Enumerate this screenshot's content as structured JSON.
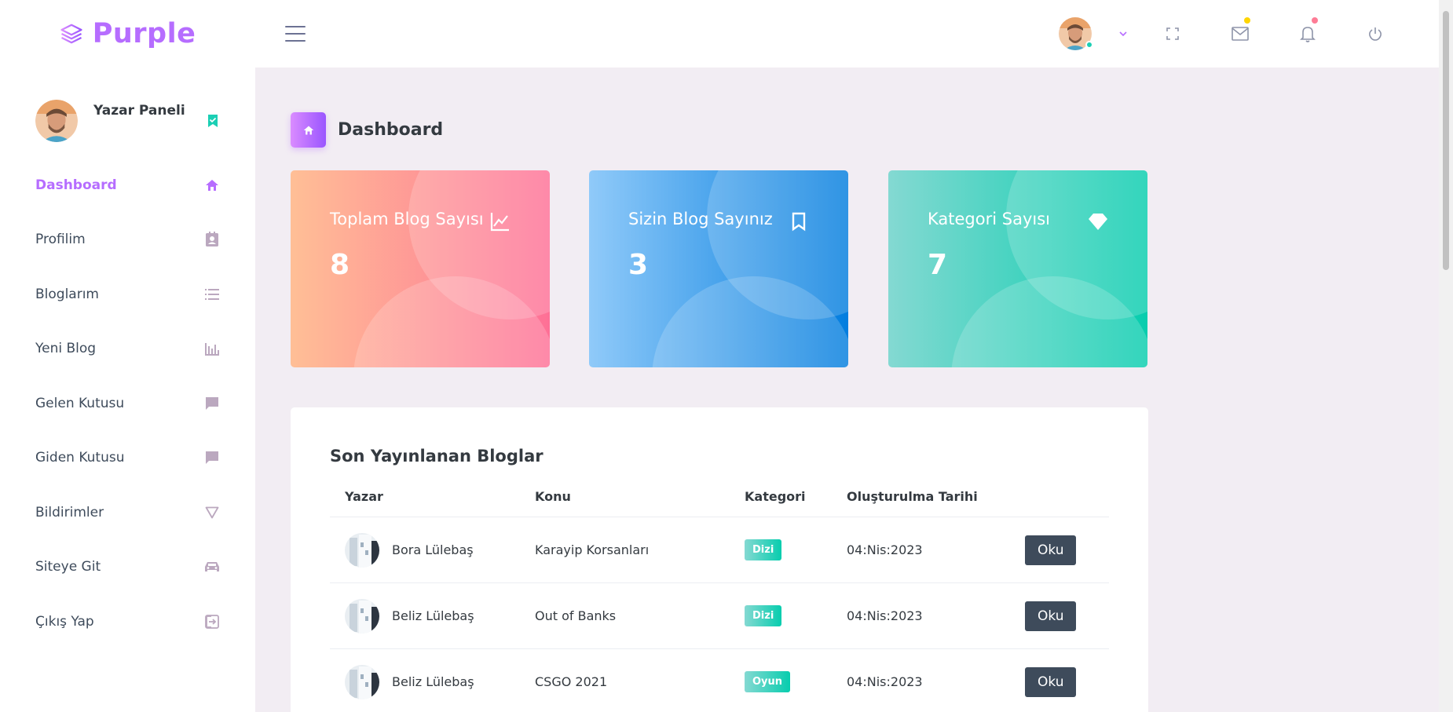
{
  "brand": {
    "name": "Purple",
    "color": "#b66dff"
  },
  "navbar": {
    "icons": [
      "chevron-down-icon",
      "fullscreen-icon",
      "mail-icon",
      "bell-icon",
      "power-icon"
    ],
    "mail_badge_color": "#ffd500",
    "bell_badge_color": "#fe7c96"
  },
  "sidebar": {
    "profile_name": "Yazar Paneli",
    "items": [
      {
        "label": "Dashboard",
        "icon": "home-icon",
        "active": true
      },
      {
        "label": "Profilim",
        "icon": "contact-card-icon"
      },
      {
        "label": "Bloglarım",
        "icon": "list-icon"
      },
      {
        "label": "Yeni Blog",
        "icon": "bar-chart-icon"
      },
      {
        "label": "Gelen Kutusu",
        "icon": "message-icon"
      },
      {
        "label": "Giden Kutusu",
        "icon": "message-icon"
      },
      {
        "label": "Bildirimler",
        "icon": "triangle-down-icon"
      },
      {
        "label": "Siteye Git",
        "icon": "car-icon"
      },
      {
        "label": "Çıkış Yap",
        "icon": "logout-icon"
      }
    ]
  },
  "page": {
    "title": "Dashboard"
  },
  "stats": [
    {
      "label": "Toplam Blog Sayısı",
      "value": "8",
      "icon": "chart-line-icon"
    },
    {
      "label": "Sizin Blog Sayınız",
      "value": "3",
      "icon": "bookmark-icon"
    },
    {
      "label": "Kategori Sayısı",
      "value": "7",
      "icon": "diamond-icon"
    }
  ],
  "recent": {
    "title": "Son Yayınlanan Bloglar",
    "columns": [
      "Yazar",
      "Konu",
      "Kategori",
      "Oluşturulma Tarihi"
    ],
    "rows": [
      {
        "author": "Bora Lülebaş",
        "topic": "Karayip Korsanları",
        "category": "Dizi",
        "date": "04:Nis:2023",
        "action": "Oku"
      },
      {
        "author": "Beliz Lülebaş",
        "topic": "Out of Banks",
        "category": "Dizi",
        "date": "04:Nis:2023",
        "action": "Oku"
      },
      {
        "author": "Beliz Lülebaş",
        "topic": "CSGO 2021",
        "category": "Oyun",
        "date": "04:Nis:2023",
        "action": "Oku"
      }
    ]
  }
}
